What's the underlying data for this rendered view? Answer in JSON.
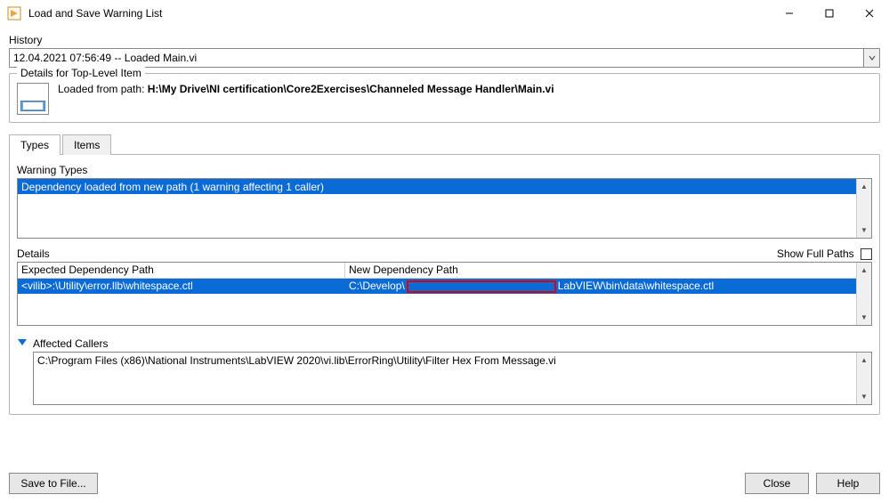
{
  "window": {
    "title": "Load and Save Warning List"
  },
  "history": {
    "label": "History",
    "selected": "12.04.2021 07:56:49 -- Loaded Main.vi"
  },
  "top_level": {
    "legend": "Details for Top-Level Item",
    "loaded_label": "Loaded from path: ",
    "loaded_path": "H:\\My Drive\\NI certification\\Core2Exercises\\Channeled Message Handler\\Main.vi"
  },
  "tabs": {
    "types": "Types",
    "items": "Items"
  },
  "warning_types": {
    "label": "Warning Types",
    "rows": [
      "Dependency loaded from new path (1 warning affecting 1 caller)"
    ]
  },
  "details": {
    "label": "Details",
    "show_full_paths": "Show Full Paths",
    "col_expected": "Expected Dependency Path",
    "col_new": "New Dependency Path",
    "rows": [
      {
        "expected": "<vilib>:\\Utility\\error.llb\\whitespace.ctl",
        "new_prefix": "C:\\Develop\\",
        "new_suffix": "LabVIEW\\bin\\data\\whitespace.ctl"
      }
    ]
  },
  "affected": {
    "label": "Affected Callers",
    "rows": [
      "C:\\Program Files (x86)\\National Instruments\\LabVIEW 2020\\vi.lib\\ErrorRing\\Utility\\Filter Hex From Message.vi"
    ]
  },
  "buttons": {
    "save": "Save to File...",
    "close": "Close",
    "help": "Help"
  }
}
